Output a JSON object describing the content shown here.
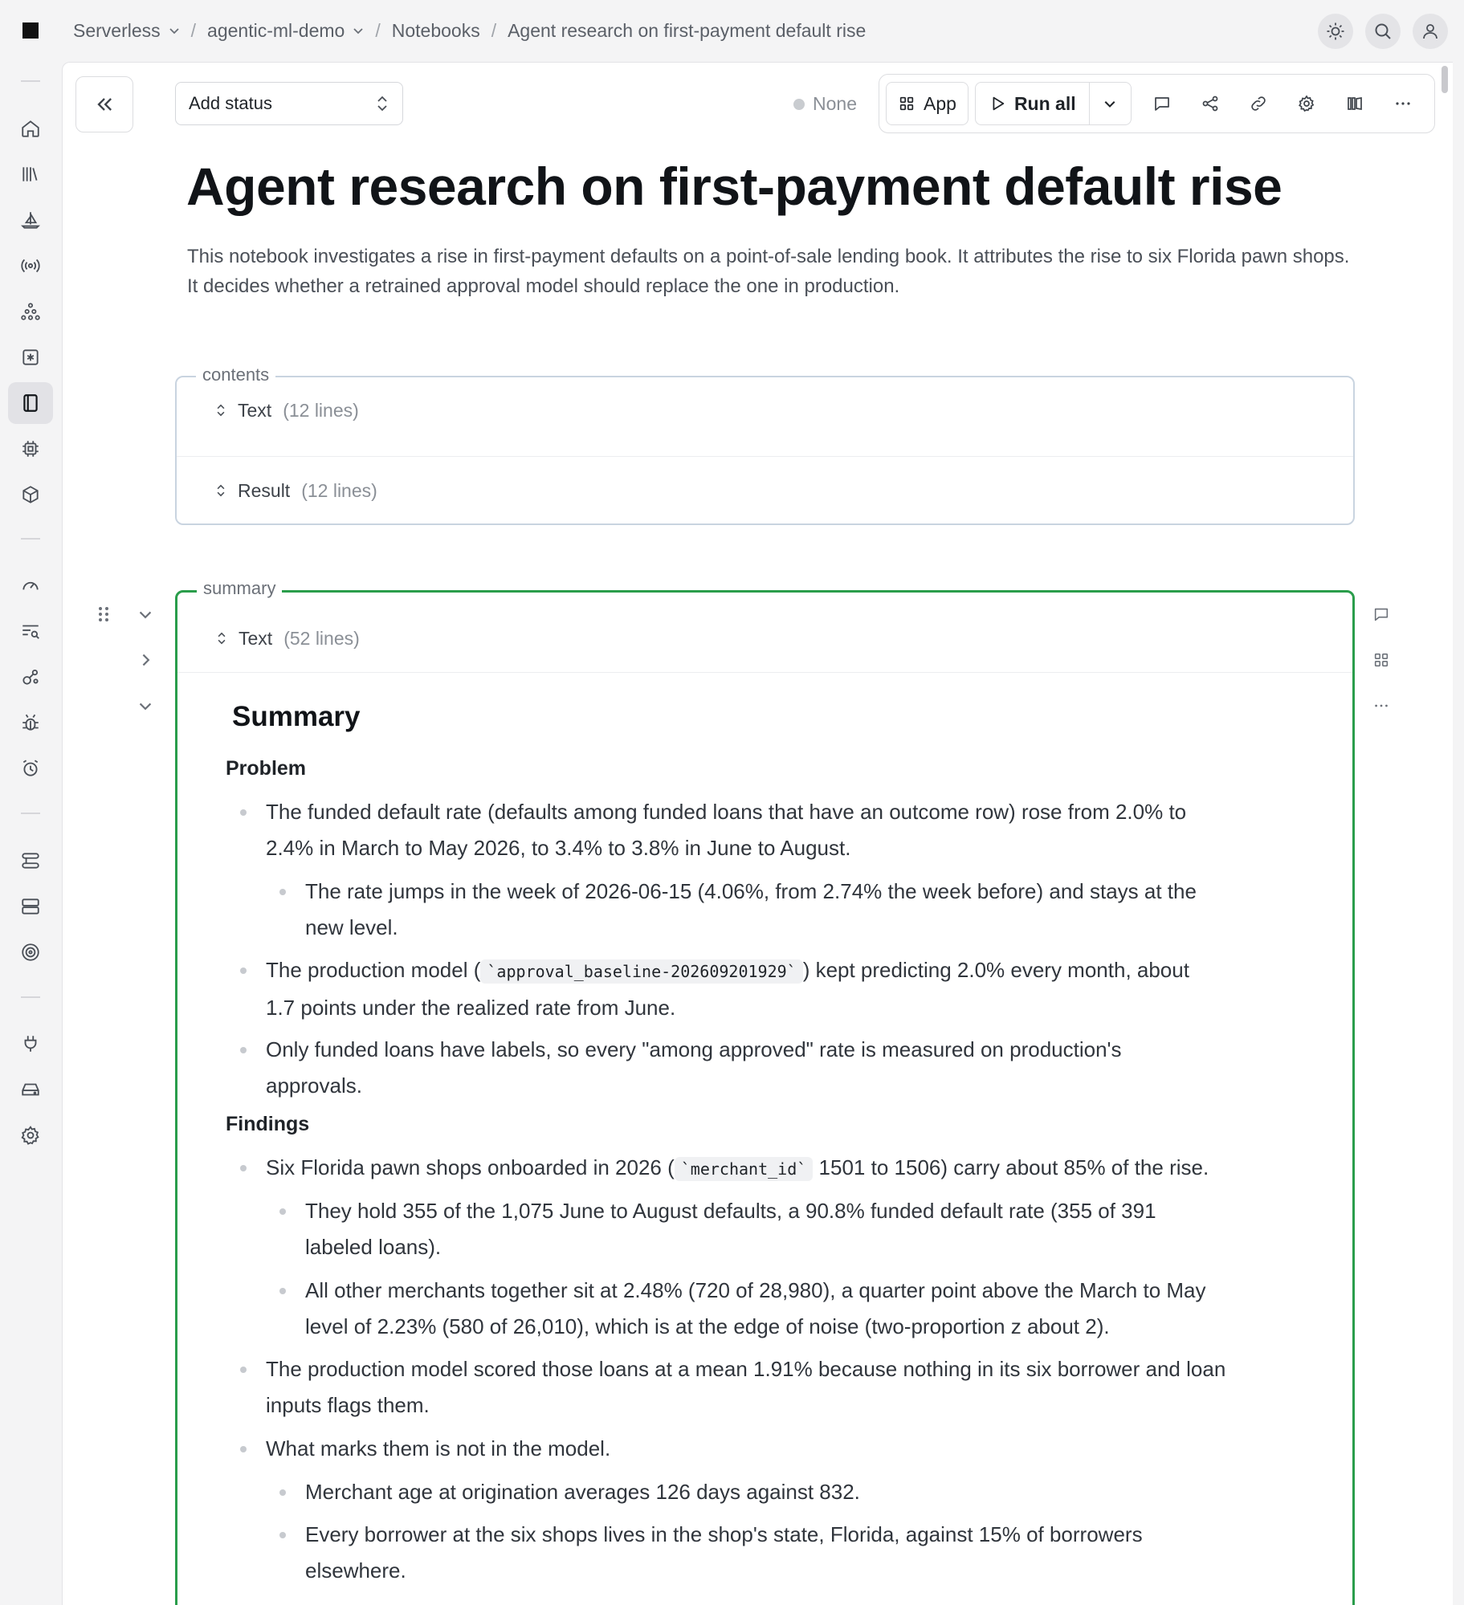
{
  "breadcrumb": {
    "workspace": "Serverless",
    "project": "agentic-ml-demo",
    "section": "Notebooks",
    "page": "Agent research on first-payment default rise",
    "separator": "/"
  },
  "header": {
    "status_placeholder": "Add status",
    "status_value": "None",
    "app_label": "App",
    "run_all_label": "Run all"
  },
  "notebook": {
    "title": "Agent research on first-payment default rise",
    "description": "This notebook investigates a rise in first-payment defaults on a point-of-sale lending book. It attributes the rise to six Florida pawn shops. It decides whether a retrained approval model should replace the one in production."
  },
  "contents_cell": {
    "label": "contents",
    "rows": [
      {
        "name": "Text",
        "count": "(12 lines)"
      },
      {
        "name": "Result",
        "count": "(12 lines)"
      }
    ]
  },
  "summary_cell": {
    "label": "summary",
    "row": {
      "name": "Text",
      "count": "(52 lines)"
    },
    "heading": "Summary",
    "sections": {
      "problem": "Problem",
      "findings": "Findings"
    },
    "items": {
      "p1_a": "The funded default rate (defaults among funded loans that have an outcome row) rose from 2.0% to",
      "p1_b": "2.4% in March to May 2026, to 3.4% to 3.8% in June to August.",
      "p1s_a": "The rate jumps in the week of 2026-06-15 (4.06%, from 2.74% the week before) and stays at the",
      "p1s_b": "new level.",
      "p2_pre": "The production model (",
      "p2_code": "`approval_baseline-202609201929`",
      "p2_post": ") kept predicting 2.0% every month, about",
      "p2_b": "1.7 points under the realized rate from June.",
      "p3_a": "Only funded loans have labels, so every \"among approved\" rate is measured on production's",
      "p3_b": "approvals.",
      "f1_pre": "Six Florida pawn shops onboarded in 2026 (",
      "f1_code": "`merchant_id`",
      "f1_post": "1501 to 1506) carry about 85% of the rise.",
      "f1s1_a": "They hold 355 of the 1,075 June to August defaults, a 90.8% funded default rate (355 of 391",
      "f1s1_b": "labeled loans).",
      "f1s2_a": "All other merchants together sit at 2.48% (720 of 28,980), a quarter point above the March to May",
      "f1s2_b": "level of 2.23% (580 of 26,010), which is at the edge of noise (two-proportion z about 2).",
      "f2_a": "The production model scored those loans at a mean 1.91% because nothing in its six borrower and loan",
      "f2_b": "inputs flags them.",
      "f3": "What marks them is not in the model.",
      "f3s1": "Merchant age at origination averages 126 days against 832.",
      "f3s2_a": "Every borrower at the six shops lives in the shop's state, Florida, against 15% of borrowers",
      "f3s2_b": "elsewhere."
    }
  },
  "colors": {
    "accent_green": "#2a9d4b",
    "contents_border": "#c9d4e0"
  }
}
